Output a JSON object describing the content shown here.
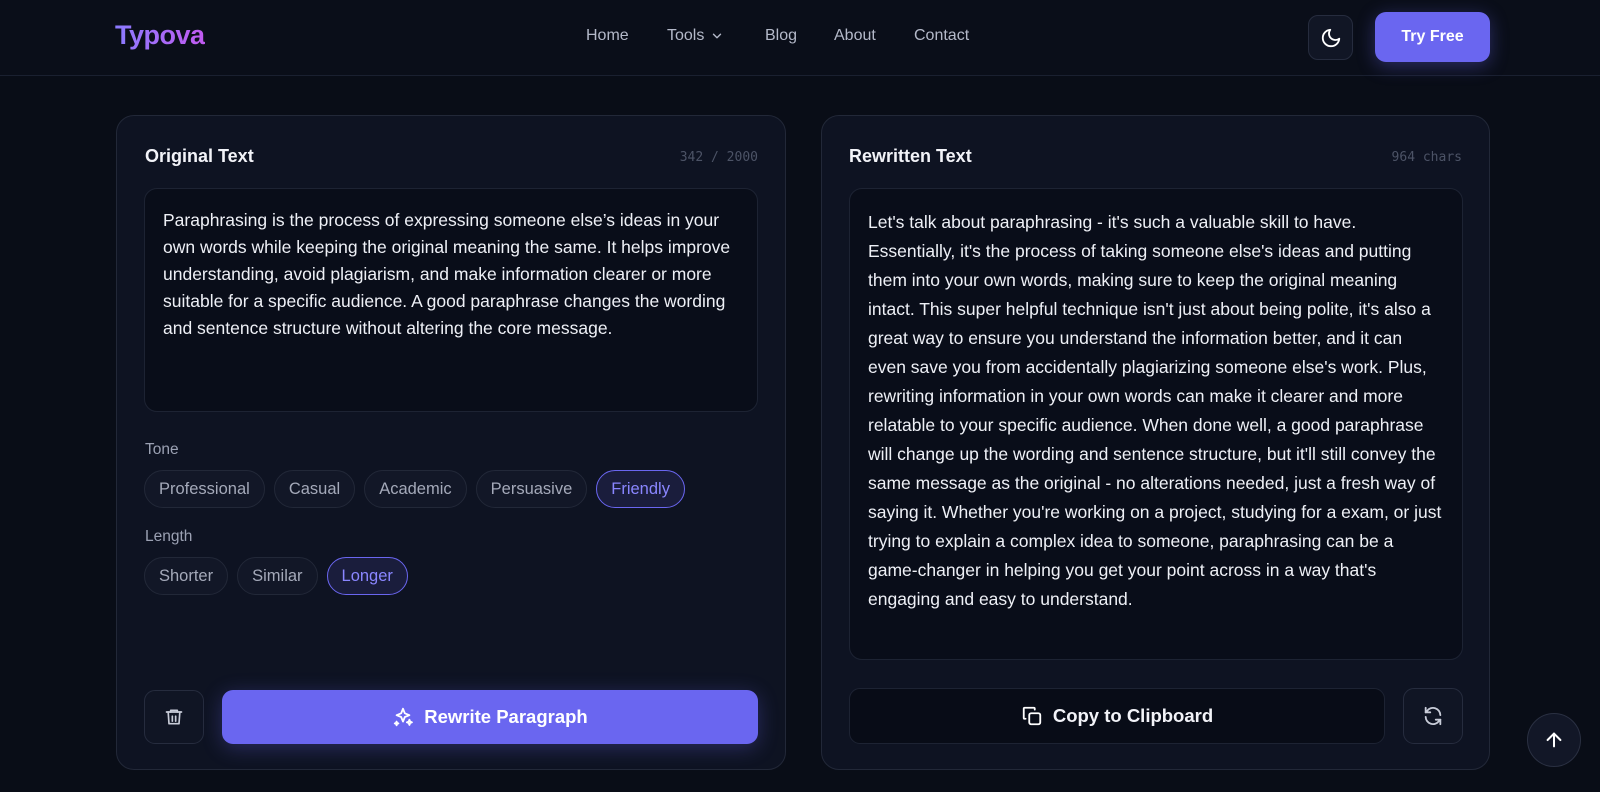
{
  "brand": {
    "name": "Typova",
    "gradient_start": "#8b7bff",
    "gradient_end": "#c15af0"
  },
  "nav": {
    "links": [
      {
        "label": "Home"
      },
      {
        "label": "Tools",
        "has_dropdown": true
      },
      {
        "label": "Blog"
      },
      {
        "label": "About"
      },
      {
        "label": "Contact"
      }
    ],
    "theme_toggle_icon": "moon-icon",
    "cta_label": "Try Free"
  },
  "original": {
    "title": "Original Text",
    "counter": "342 / 2000",
    "text": "Paraphrasing is the process of expressing someone else’s ideas in your own words while keeping the original meaning the same. It helps improve understanding, avoid plagiarism, and make information clearer or more suitable for a specific audience. A good paraphrase changes the wording and sentence structure without altering the core message.",
    "tone": {
      "label": "Tone",
      "options": [
        "Professional",
        "Casual",
        "Academic",
        "Persuasive",
        "Friendly"
      ],
      "selected": "Friendly"
    },
    "length": {
      "label": "Length",
      "options": [
        "Shorter",
        "Similar",
        "Longer"
      ],
      "selected": "Longer"
    },
    "delete_icon": "trash-icon",
    "rewrite_label": "Rewrite Paragraph",
    "rewrite_icon": "sparkles-icon"
  },
  "rewritten": {
    "title": "Rewritten Text",
    "counter": "964 chars",
    "text": "Let's talk about paraphrasing - it's such a valuable skill to have. Essentially, it's the process of taking someone else's ideas and putting them into your own words, making sure to keep the original meaning intact. This super helpful technique isn't just about being polite, it's also a great way to ensure you understand the information better, and it can even save you from accidentally plagiarizing someone else's work. Plus, rewriting information in your own words can make it clearer and more relatable to your specific audience. When done well, a good paraphrase will change up the wording and sentence structure, but it'll still convey the same message as the original - no alterations needed, just a fresh way of saying it. Whether you're working on a project, studying for a exam, or just trying to explain a complex idea to someone, paraphrasing can be a game-changer in helping you get your point across in a way that's engaging and easy to understand.",
    "copy_label": "Copy to Clipboard",
    "copy_icon": "copy-icon",
    "refresh_icon": "refresh-icon"
  },
  "scroll_top_icon": "arrow-up-icon",
  "colors": {
    "accent": "#6a66f0",
    "background": "#090d17",
    "panel": "#0e1322"
  }
}
